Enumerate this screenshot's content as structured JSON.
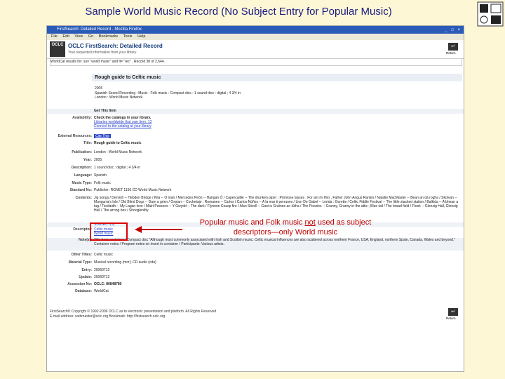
{
  "slide": {
    "title": "Sample World Music Record (No Subject Entry for Popular Music)"
  },
  "browser": {
    "window_title": "FirstSearch: Detailed Record - Mozilla Firefox",
    "menu": [
      "File",
      "Edit",
      "View",
      "Go",
      "Bookmarks",
      "Tools",
      "Help"
    ]
  },
  "header": {
    "logo_text": "OCLC",
    "title": "OCLC FirstSearch: Detailed Record",
    "subtitle": "Your requested information from your library",
    "return_label": "Return"
  },
  "search_bar": {
    "text": "WorldCat results for: su= \"world music\" and lt= \"rec\" . Record 38 of 2,644."
  },
  "record": {
    "title": "Rough guide to Celtic music",
    "summary_lines": [
      "2005",
      "Spanish Sound Recording : Music : Folk music : Compact disc : 1 sound disc : digital ; 4 3/4 in",
      "London : World Music Network."
    ],
    "get_this_item": "Get This Item",
    "fields": [
      {
        "label": "Availability:",
        "value": "Check the catalogs in your library."
      },
      {
        "label": "",
        "value": "Libraries worldwide that own item: 13"
      },
      {
        "label": "",
        "value": "Connect to the catalog at your library"
      },
      {
        "label": "External Resources:",
        "value": "Cite This"
      },
      {
        "label": "Title:",
        "value": "Rough guide to Celtic music"
      },
      {
        "label": "Publication:",
        "value": "London : World Music Network"
      },
      {
        "label": "Year:",
        "value": "2005"
      },
      {
        "label": "Description:",
        "value": "1 sound disc : digital ; 4 3/4 in"
      },
      {
        "label": "Language:",
        "value": "Spanish"
      },
      {
        "label": "Music Type:",
        "value": "Folk music"
      },
      {
        "label": "Standard No:",
        "value": "Publisher: RGNET 1156 CD World Music Network"
      },
      {
        "label": "Contents:",
        "value": "Jig songs / Dervish -- Hebden Bridge / Kila -- O man / Mercedes Peón -- Hairgan Ó / Capercaillie -- The drunken piper ; Primrose lasses ; For am mi fhin , Father John Angus Rankin / Natalie MacMaster -- Bean an dá rogha / Skolvan -- Mungurra's Isle / Old Blind Dogs -- Darn a grinn / Ossian -- Cochetaje ; Romanes -- Carlos / Carlos Núñez -- A la mar ti perrunes / Lion De Gabel -- Lerida : Gorette / Celtic Fiddle Festival -- The little stacked station / Balkida -- A bhean a tug / Tiocfaidh -- My Lagan love / Máirt Pessons -- Y Gwydd -- The dark / Flynnon Ceasp fire / Alan Stivell -- Gaoi is Gráinne an Iútha / The Poozies -- Granny, Granny in the attic ; Blue tail / The broad field / Flook -- Glenzig Hall, Glenzig Hall / The wrong box / Shooglenifty."
      },
      {
        "label": "SUBJECT(S)",
        "value": ""
      },
      {
        "label": "Descriptor:",
        "value": "Celtic music"
      },
      {
        "label": "",
        "value": "World music"
      },
      {
        "label": "Note(s):",
        "value": "Title from container / Compact disc \"Although most commonly associated with Irish and Scottish music, Celtic musical influences are also scattered across northern France, USA, England, northern Spain, Canada, Wales and beyond.\" Container notes / Program notes on insert in container / Participants: Various artists."
      },
      {
        "label": "Other Titles:",
        "value": "Celtic music"
      },
      {
        "label": "Material Type:",
        "value": "Musical recording (mcr); CD audio (cda)"
      },
      {
        "label": "Entry:",
        "value": "20060712"
      },
      {
        "label": "Update:",
        "value": "20060712"
      },
      {
        "label": "Accession No:",
        "value": "OCLC: 80848780"
      },
      {
        "label": "Database:",
        "value": "WorldCat"
      }
    ]
  },
  "footer": {
    "line1": "FirstSearch® Copyright © 1992-2006 OCLC as to electronic presentation and platform. All Rights Reserved.",
    "line2": "E-mail address: webmaster@oclc.org   Bookmark: http://firstsearch.oclc.org"
  },
  "callout": {
    "line1_pre": "Popular music and Folk music ",
    "line1_underlined": "not",
    "line1_post": " used as subject",
    "line2": "descriptors—only World music"
  },
  "colors": {
    "slide_background": "#fdf7d6",
    "title_text": "#1a1a80",
    "callout_text": "#c00000",
    "highlight_box": "#dd0000"
  },
  "icons": {
    "corner": "media-types-icon",
    "return": "return-arrow-icon"
  }
}
